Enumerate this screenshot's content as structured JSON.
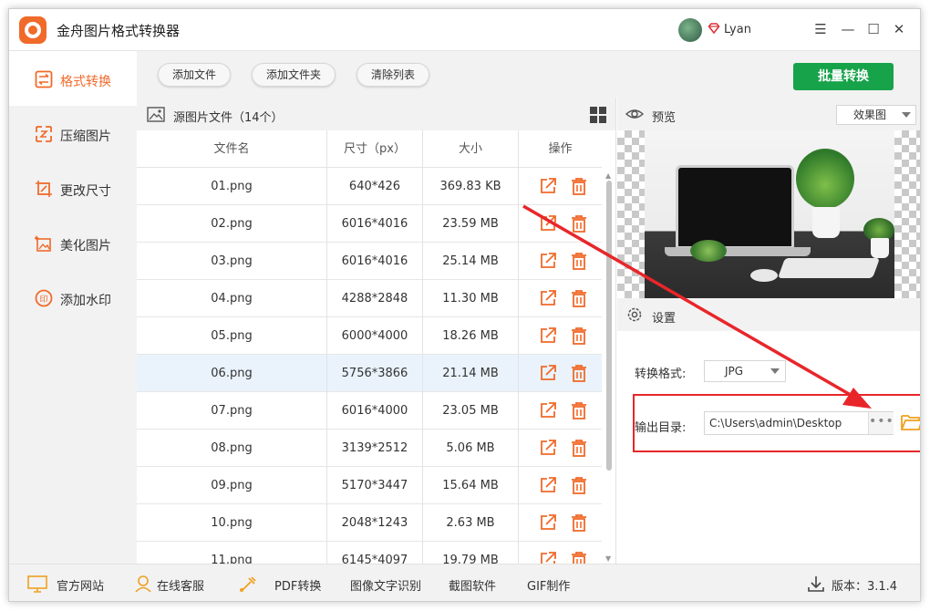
{
  "app": {
    "title": "金舟图片格式转换器",
    "user_name": "Lyan",
    "window_controls": {
      "menu": "☰",
      "minimize": "—",
      "maximize": "☐",
      "close": "✕"
    }
  },
  "sidebar": {
    "items": [
      {
        "label": "格式转换",
        "icon": "convert-icon",
        "active": true
      },
      {
        "label": "压缩图片",
        "icon": "compress-icon",
        "active": false
      },
      {
        "label": "更改尺寸",
        "icon": "resize-icon",
        "active": false
      },
      {
        "label": "美化图片",
        "icon": "beautify-icon",
        "active": false
      },
      {
        "label": "添加水印",
        "icon": "watermark-icon",
        "active": false
      }
    ]
  },
  "toolbar": {
    "add_file": "添加文件",
    "add_folder": "添加文件夹",
    "clear_list": "清除列表",
    "batch_convert": "批量转换"
  },
  "file_list": {
    "title": "源图片文件（14个）",
    "columns": [
      "文件名",
      "尺寸（px）",
      "大小",
      "操作"
    ],
    "rows": [
      {
        "name": "01.png",
        "size_px": "640*426",
        "file_size": "369.83 KB"
      },
      {
        "name": "02.png",
        "size_px": "6016*4016",
        "file_size": "23.59 MB"
      },
      {
        "name": "03.png",
        "size_px": "6016*4016",
        "file_size": "25.14 MB"
      },
      {
        "name": "04.png",
        "size_px": "4288*2848",
        "file_size": "11.30 MB"
      },
      {
        "name": "05.png",
        "size_px": "6000*4000",
        "file_size": "18.26 MB"
      },
      {
        "name": "06.png",
        "size_px": "5756*3866",
        "file_size": "21.14 MB",
        "selected": true
      },
      {
        "name": "07.png",
        "size_px": "6016*4000",
        "file_size": "23.05 MB"
      },
      {
        "name": "08.png",
        "size_px": "3139*2512",
        "file_size": "5.06 MB"
      },
      {
        "name": "09.png",
        "size_px": "5170*3447",
        "file_size": "15.64 MB"
      },
      {
        "name": "10.png",
        "size_px": "2048*1243",
        "file_size": "2.63 MB"
      },
      {
        "name": "11.png",
        "size_px": "6145*4097",
        "file_size": "19.79 MB"
      }
    ]
  },
  "preview": {
    "title": "预览",
    "mode": "效果图"
  },
  "settings": {
    "title": "设置",
    "format_label": "转换格式:",
    "format_value": "JPG",
    "output_label": "输出目录:",
    "output_path": "C:\\Users\\admin\\Desktop",
    "browse_dots": "•••"
  },
  "footer": {
    "official_site": "官方网站",
    "online_service": "在线客服",
    "pdf_convert": "PDF转换",
    "ocr": "图像文字识别",
    "screenshot": "截图软件",
    "gif": "GIF制作",
    "version": "版本：3.1.4"
  },
  "colors": {
    "accent": "#f06a2a",
    "primary_button": "#17a34a",
    "annotation": "#e8262a",
    "selected_row": "#eaf3fb"
  }
}
